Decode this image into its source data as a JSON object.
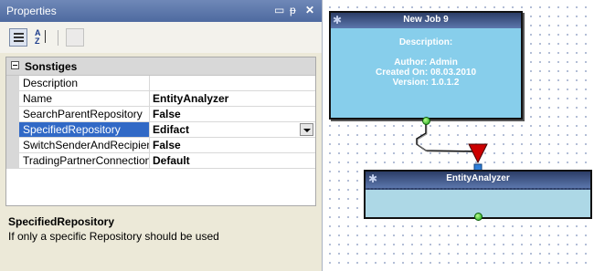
{
  "panel": {
    "title": "Properties",
    "controls": {
      "dropdown_glyph": "▭",
      "pin_glyph": "ᵽ",
      "close_glyph": "✕"
    },
    "toolbar": {
      "categorized_icon": "categorized-list-icon",
      "alphabetical_icon": "alphabetical-sort-icon",
      "property_pages_icon": "property-pages-icon",
      "az_top": "A",
      "az_bottom": "Z"
    },
    "category": "Sonstiges",
    "properties": [
      {
        "name": "Description",
        "value": ""
      },
      {
        "name": "Name",
        "value": "EntityAnalyzer"
      },
      {
        "name": "SearchParentRepository",
        "value": "False"
      },
      {
        "name": "SpecifiedRepository",
        "value": "Edifact",
        "selected": true
      },
      {
        "name": "SwitchSenderAndRecipient",
        "value": "False"
      },
      {
        "name": "TradingPartnerConnection",
        "value": "Default"
      }
    ],
    "help": {
      "title": "SpecifiedRepository",
      "text": "If only a specific Repository should be used"
    }
  },
  "canvas": {
    "job_node": {
      "title": "New Job 9",
      "description_label": "Description:",
      "author": "Author: Admin",
      "created": "Created On: 08.03.2010",
      "version": "Version: 1.0.1.2",
      "icon": "gear-icon"
    },
    "analyzer_node": {
      "title": "EntityAnalyzer",
      "icon": "gear-icon"
    },
    "colors": {
      "job_body": "#87ceeb",
      "analyzer_body": "#add8e6",
      "connector_arrow": "#cc0000",
      "port": "#1aa01a"
    }
  }
}
